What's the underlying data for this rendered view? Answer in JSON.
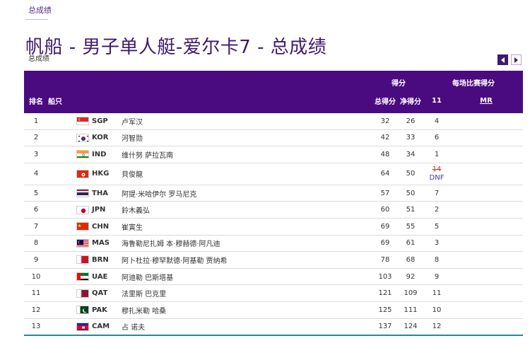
{
  "breadcrumb": "总成绩",
  "page_title": "帆船 - 男子单人艇-爱尔卡7 - 总成绩",
  "section_label": "总成绩",
  "header": {
    "rank": "排名",
    "boat": "船只",
    "points_group": "得分",
    "race_group": "每场比赛得分",
    "total": "总得分",
    "net": "净得分",
    "race_11": "11",
    "mr": "MR"
  },
  "rows": [
    {
      "rank": "1",
      "noc": "SGP",
      "athlete": "卢军汉",
      "total": "32",
      "net": "26",
      "r11": "4",
      "flag": "flag-sgp"
    },
    {
      "rank": "2",
      "noc": "KOR",
      "athlete": "河智勋",
      "total": "42",
      "net": "33",
      "r11": "6",
      "flag": "flag-kor"
    },
    {
      "rank": "3",
      "noc": "IND",
      "athlete": "维什努 萨拉瓦南",
      "total": "48",
      "net": "34",
      "r11": "1",
      "flag": "flag-ind"
    },
    {
      "rank": "4",
      "noc": "HKG",
      "athlete": "貝俊龍",
      "total": "64",
      "net": "50",
      "r11_discard": "14",
      "r11": "DNF",
      "flag": "flag-hkg"
    },
    {
      "rank": "5",
      "noc": "THA",
      "athlete": "阿提·米哈伊尔 罗马尼克",
      "total": "57",
      "net": "50",
      "r11": "7",
      "flag": "flag-tha"
    },
    {
      "rank": "6",
      "noc": "JPN",
      "athlete": "鈴木義弘",
      "total": "60",
      "net": "51",
      "r11": "2",
      "flag": "flag-jpn"
    },
    {
      "rank": "7",
      "noc": "CHN",
      "athlete": "崔寅生",
      "total": "69",
      "net": "55",
      "r11": "5",
      "flag": "flag-chn"
    },
    {
      "rank": "8",
      "noc": "MAS",
      "athlete": "海鲁勒尼扎姆 本·穆赫德·阿凡迪",
      "total": "69",
      "net": "61",
      "r11": "3",
      "flag": "flag-mas"
    },
    {
      "rank": "9",
      "noc": "BRN",
      "athlete": "阿卜杜拉·穆罕默德·阿基勒 贾纳希",
      "total": "78",
      "net": "68",
      "r11": "8",
      "flag": "flag-brn"
    },
    {
      "rank": "10",
      "noc": "UAE",
      "athlete": "阿迪勒 巴斯塔基",
      "total": "103",
      "net": "92",
      "r11": "9",
      "flag": "flag-uae"
    },
    {
      "rank": "11",
      "noc": "QAT",
      "athlete": "法里斯 巴克里",
      "total": "121",
      "net": "109",
      "r11": "11",
      "flag": "flag-qat"
    },
    {
      "rank": "12",
      "noc": "PAK",
      "athlete": "穆扎米勒 哈桑",
      "total": "125",
      "net": "111",
      "r11": "10",
      "flag": "flag-pak"
    },
    {
      "rank": "13",
      "noc": "CAM",
      "athlete": "占 诺夫",
      "total": "137",
      "net": "124",
      "r11": "12",
      "flag": "flag-cam"
    }
  ],
  "colors": {
    "header_bg": "#4a0b80",
    "title": "#3d1a6e",
    "discard": "#c0392b",
    "bottom_rule": "#2a8a8a"
  }
}
